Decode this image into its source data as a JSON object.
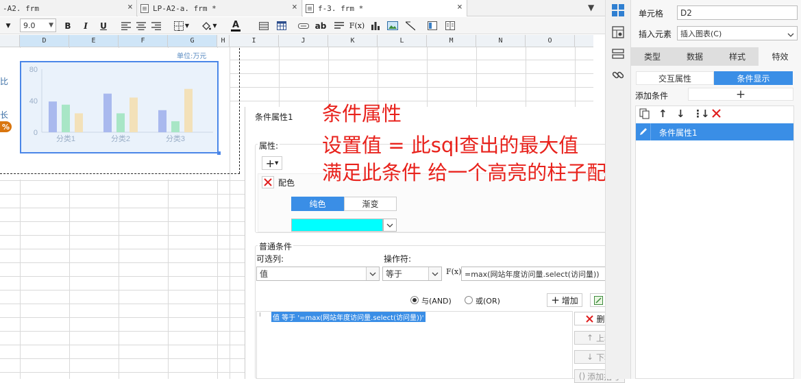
{
  "tabs": [
    {
      "label": "-A2. frm",
      "active": false
    },
    {
      "label": "LP-A2-a. frm *",
      "active": false
    },
    {
      "label": "f-3. frm *",
      "active": true
    }
  ],
  "toolbar": {
    "font_size": "9.0",
    "bold": "B",
    "italic": "I",
    "underline": "U",
    "font_color_glyph": "A",
    "text_glyph": "ab",
    "formula_glyph": "F(x)"
  },
  "sheet": {
    "columns": [
      "D",
      "E",
      "F",
      "G",
      "H",
      "I",
      "J",
      "K",
      "L",
      "M",
      "N",
      "O"
    ],
    "selected_columns": [
      "D",
      "E",
      "F",
      "G"
    ],
    "unit_label": "单位:万元",
    "left_fragments": [
      "比",
      "长",
      "%"
    ]
  },
  "chart_data": {
    "type": "bar",
    "categories": [
      "分类1",
      "分类2",
      "分类3"
    ],
    "series": [
      {
        "values": [
          39,
          49,
          28
        ],
        "color": "#a9b9ee"
      },
      {
        "values": [
          35,
          24,
          14
        ],
        "color": "#a8e6c6"
      },
      {
        "values": [
          24,
          44,
          55
        ],
        "color": "#f3e1b9"
      }
    ],
    "yticks": [
      "80",
      "40",
      "0"
    ],
    "ylim": [
      0,
      80
    ]
  },
  "annotation": {
    "line1": "条件属性",
    "line2": "设置值 = 此sql查出的最大值",
    "line3": "满足此条件 给一个高亮的柱子配色"
  },
  "condition_panel": {
    "title": "条件属性1",
    "attr_label": "属性:",
    "add_glyph": "+",
    "color_label": "配色",
    "solid_tab": "纯色",
    "gradient_tab": "渐变",
    "selected_color": "#00ffff",
    "normal_cond_label": "普通条件",
    "column_label": "可选列:",
    "column_value": "值",
    "operator_label": "操作符:",
    "operator_value": "等于",
    "fx_label": "F(x)",
    "formula_value": "=max(网站年度访问量.select(访问量))",
    "and_label": "与(AND)",
    "or_label": "或(OR)",
    "add_button": "增加",
    "modify_button": "修改",
    "condition_item": "值 等于 '=max(网站年度访问量.select(访问量))'",
    "delete_button": "删除",
    "up_button": "上移",
    "down_button": "下移",
    "bracket_button": "添加括号"
  },
  "right_panel": {
    "cell_label": "单元格",
    "cell_value": "D2",
    "insert_label": "插入元素",
    "insert_value": "插入图表(C)",
    "tabs": [
      "类型",
      "数据",
      "样式",
      "特效"
    ],
    "active_tab": "特效",
    "subtabs": [
      "交互属性",
      "条件显示"
    ],
    "active_subtab": "条件显示",
    "add_condition_label": "添加条件",
    "add_glyph": "+",
    "condition_item": "条件属性1"
  }
}
